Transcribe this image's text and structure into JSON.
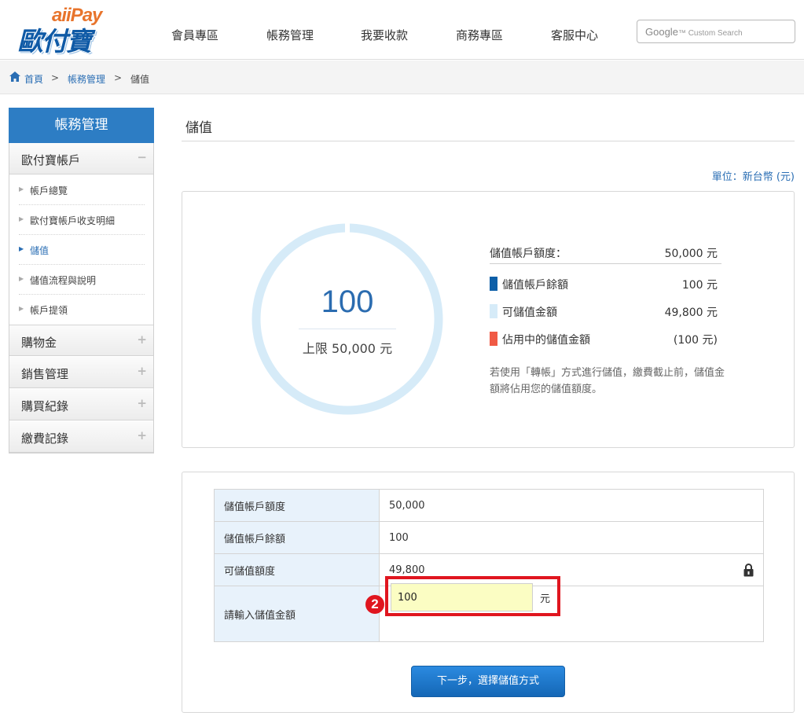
{
  "header": {
    "logo_top": "aiiPay",
    "logo_main": "歐付寶",
    "nav": [
      "會員專區",
      "帳務管理",
      "我要收款",
      "商務專區",
      "客服中心"
    ],
    "search_brand": "Google",
    "search_placeholder": "Custom Search"
  },
  "breadcrumb": {
    "home": "首頁",
    "sep": ">",
    "level1": "帳務管理",
    "current": "儲值"
  },
  "sidebar": {
    "title": "帳務管理",
    "groups": [
      {
        "label": "歐付寶帳戶",
        "sign": "−"
      },
      {
        "label": "購物金",
        "sign": "+"
      },
      {
        "label": "銷售管理",
        "sign": "+"
      },
      {
        "label": "購買紀錄",
        "sign": "+"
      },
      {
        "label": "繳費記錄",
        "sign": "+"
      }
    ],
    "sub_items": [
      "帳戶總覽",
      "歐付寶帳戶收支明細",
      "儲值",
      "儲值流程與說明",
      "帳戶提領"
    ],
    "arrow": "▶"
  },
  "main": {
    "title": "儲值",
    "unit": "單位：新台幣 (元)"
  },
  "summary": {
    "ring_value": "100",
    "ring_limit": "上限 50,000 元",
    "ring_fill": 0.002,
    "quota_label": "儲值帳戶額度：",
    "quota_value": "50,000 元",
    "balance_label": "儲值帳戶餘額",
    "balance_value": "100 元",
    "available_label": "可儲值金額",
    "available_value": "49,800 元",
    "occupied_label": "佔用中的儲值金額",
    "occupied_value": "(100 元)",
    "note": "若使用「轉帳」方式進行儲值，繳費截止前，儲值金額將佔用您的儲值額度。"
  },
  "form": {
    "rows": [
      {
        "label": "儲值帳戶額度",
        "value": "50,000"
      },
      {
        "label": "儲值帳戶餘額",
        "value": "100"
      },
      {
        "label": "可儲值額度",
        "value": "49,800"
      }
    ],
    "input_label": "請輸入儲值金額",
    "input_value": "100",
    "input_unit": "元",
    "step_badge": "2",
    "submit_label": "下一步，選擇儲值方式"
  },
  "colors": {
    "brand_blue": "#2d7dc4",
    "link_blue": "#2a6eb4",
    "balance_swatch": "#0d5fa8",
    "available_swatch": "#d6ebf8",
    "occupied_swatch": "#f05a45",
    "highlight_red": "#e0161f",
    "input_yellow": "#fbfdc3"
  },
  "icons": [
    "home-icon",
    "lock-icon",
    "minus-icon",
    "plus-icon",
    "arrow-right-icon"
  ]
}
